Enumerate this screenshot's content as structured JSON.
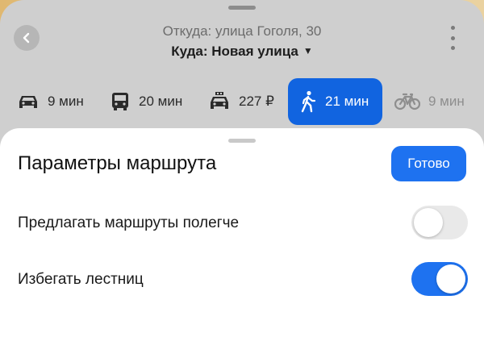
{
  "route": {
    "from_label": "Откуда: улица Гоголя, 30",
    "to_label": "Куда: Новая улица",
    "caret": "▼"
  },
  "modes": [
    {
      "icon": "car-icon",
      "label": "9 мин"
    },
    {
      "icon": "bus-icon",
      "label": "20 мин"
    },
    {
      "icon": "taxi-icon",
      "label": "227 ₽"
    },
    {
      "icon": "walking-icon",
      "label": "21 мин",
      "active": true
    },
    {
      "icon": "bicycle-icon",
      "label": "9 мин"
    }
  ],
  "sheet": {
    "title": "Параметры маршрута",
    "done_label": "Готово",
    "options": [
      {
        "label": "Предлагать маршруты полегче",
        "enabled": false
      },
      {
        "label": "Избегать лестниц",
        "enabled": true
      }
    ]
  },
  "colors": {
    "accent": "#1e72f0",
    "active_mode": "#1164e0"
  }
}
